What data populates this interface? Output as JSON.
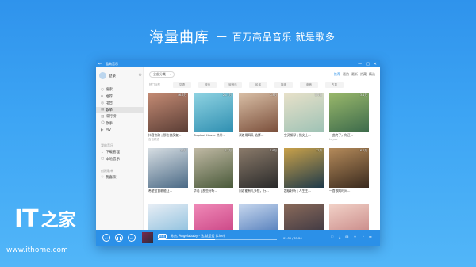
{
  "headline": {
    "main": "海量曲库",
    "dash": "—",
    "sub": "百万高品音乐 就是歌多"
  },
  "watermark": {
    "logo_it": "IT",
    "logo_char": "之家",
    "url": "www.ithome.com"
  },
  "window": {
    "title": "酷狗音乐",
    "back": "←",
    "controls": [
      "—",
      "□",
      "✕"
    ]
  },
  "user": {
    "name": "登录",
    "settings_icon": "gear-icon"
  },
  "sidebar": {
    "items": [
      {
        "label": "搜索",
        "icon": "search-icon"
      },
      {
        "label": "推荐",
        "icon": "home-icon"
      },
      {
        "label": "电台",
        "icon": "radio-icon"
      },
      {
        "label": "歌单",
        "icon": "playlist-icon",
        "active": true
      },
      {
        "label": "排行榜",
        "icon": "chart-icon"
      },
      {
        "label": "歌手",
        "icon": "singer-icon"
      },
      {
        "label": "MV",
        "icon": "video-icon"
      }
    ],
    "my_music_head": "我的音乐",
    "my_music": [
      {
        "label": "下载管理",
        "icon": "download-icon"
      },
      {
        "label": "本地音乐",
        "icon": "folder-icon"
      }
    ],
    "created_head": "创建歌单",
    "created": [
      {
        "label": "我喜欢",
        "icon": "heart-icon"
      }
    ]
  },
  "main": {
    "filter": "全部分类",
    "sorts": [
      "推荐",
      "最热",
      "最新",
      "热藏",
      "精选"
    ],
    "tags": [
      "热门标签",
      "华语",
      "流行",
      "轻音乐",
      "民谣",
      "摇滚",
      "电音",
      "古风"
    ],
    "cards": [
      {
        "title": "抖音热歌 | 那些被反复...",
        "author": "吉他精选",
        "plays": "46.6万",
        "c1": "#5a3d35",
        "c2": "#c48b74"
      },
      {
        "title": "Tropical House 热带...",
        "author": "",
        "plays": "21.7万",
        "c1": "#2f8fb1",
        "c2": "#8fd3e2"
      },
      {
        "title": "试着用耳朵 选择...",
        "author": "",
        "plays": "7.3万",
        "c1": "#7a4e3a",
        "c2": "#d9bfa6"
      },
      {
        "title": "空灵钢琴 | 指尖上...",
        "author": "",
        "plays": "5.4万",
        "c1": "#9ec2b5",
        "c2": "#e8e1c9"
      },
      {
        "title": "一曲终了，你还...",
        "author": "Layaa",
        "plays": "3.1万",
        "c1": "#3c6a4b",
        "c2": "#9ab86b"
      },
      {
        "title": "希望这首歌能让...",
        "author": "",
        "plays": "16万",
        "c1": "#4b6a86",
        "c2": "#d6dde2"
      },
      {
        "title": "华语 | 那些好听...",
        "author": "",
        "plays": "8.1万",
        "c1": "#4a5a3a",
        "c2": "#c0b9a4"
      },
      {
        "title": "问君能有几多愁，行...",
        "author": "",
        "plays": "5.9万",
        "c1": "#2a2a2a",
        "c2": "#8a7a6a"
      },
      {
        "title": "超级好听 | 人生主...",
        "author": "",
        "plays": "12万",
        "c1": "#1f3a4a",
        "c2": "#c9a14a"
      },
      {
        "title": "一首歌的时间...",
        "author": "",
        "plays": "6.2万",
        "c1": "#3a2a1e",
        "c2": "#b48a5a"
      },
      {
        "title": "",
        "author": "",
        "plays": "",
        "c1": "#7ab6d9",
        "c2": "#e8eef5"
      },
      {
        "title": "",
        "author": "",
        "plays": "",
        "c1": "#c2367a",
        "c2": "#f08ab8"
      },
      {
        "title": "",
        "author": "",
        "plays": "",
        "c1": "#3a6ab0",
        "c2": "#c7d7ee"
      },
      {
        "title": "",
        "author": "",
        "plays": "",
        "c1": "#2d2d3d",
        "c2": "#8a6a5a"
      },
      {
        "title": "",
        "author": "",
        "plays": "",
        "c1": "#c07a7a",
        "c2": "#f2d2c8"
      }
    ]
  },
  "player": {
    "badge": "标准",
    "now_playing": "陈杰, Angelababy - 这,就是爱 (Live)",
    "time": "01:39 / 03:26",
    "progress": 0.48,
    "icons": [
      "heart-icon",
      "download-icon",
      "comment-icon",
      "share-icon",
      "volume-icon",
      "list-icon"
    ]
  }
}
